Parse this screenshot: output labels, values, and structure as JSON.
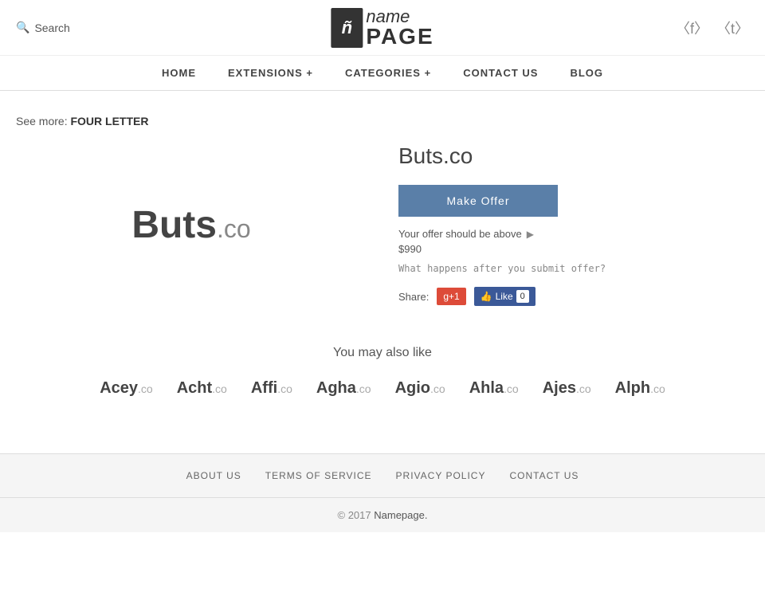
{
  "header": {
    "search_label": "Search",
    "logo_icon": "ñ",
    "logo_name": "name",
    "logo_page": "PAGE",
    "facebook_icon": "f",
    "twitter_icon": "t"
  },
  "nav": {
    "items": [
      {
        "label": "HOME",
        "id": "home"
      },
      {
        "label": "EXTENSIONS +",
        "id": "extensions"
      },
      {
        "label": "CATEGORIES +",
        "id": "categories"
      },
      {
        "label": "CONTACT US",
        "id": "contact"
      },
      {
        "label": "BLOG",
        "id": "blog"
      }
    ]
  },
  "see_more": {
    "prefix": "See more:",
    "link_label": "FOUR LETTER"
  },
  "product": {
    "logo_main": "Buts",
    "logo_ext": ".co",
    "title": "Buts.co",
    "cta_label": "Make Offer",
    "offer_hint": "Your offer should be above",
    "offer_price": "$990",
    "what_happens": "What happens after you submit offer?",
    "share_label": "Share:",
    "gplus_label": "g+1",
    "fb_label": "Like",
    "fb_count": "0"
  },
  "also_like": {
    "heading": "You may also like",
    "domains": [
      {
        "name": "Acey",
        "ext": ".co"
      },
      {
        "name": "Acht",
        "ext": ".co"
      },
      {
        "name": "Affi",
        "ext": ".co"
      },
      {
        "name": "Agha",
        "ext": ".co"
      },
      {
        "name": "Agio",
        "ext": ".co"
      },
      {
        "name": "Ahla",
        "ext": ".co"
      },
      {
        "name": "Ajes",
        "ext": ".co"
      },
      {
        "name": "Alph",
        "ext": ".co"
      }
    ]
  },
  "footer": {
    "links": [
      {
        "label": "ABOUT US",
        "id": "about-us"
      },
      {
        "label": "TERMS OF SERVICE",
        "id": "terms"
      },
      {
        "label": "PRIVACY POLICY",
        "id": "privacy"
      },
      {
        "label": "CONTACT US",
        "id": "contact"
      }
    ],
    "copy_prefix": "© 2017 ",
    "copy_brand": "Namepage.",
    "copy_year": "2017"
  }
}
